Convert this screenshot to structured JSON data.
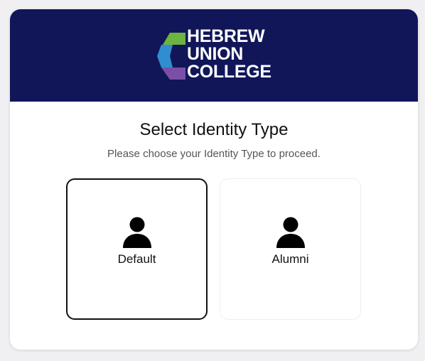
{
  "header": {
    "logo": {
      "lines": [
        "HEBREW",
        "UNION",
        "COLLEGE"
      ],
      "colors": {
        "green": "#6db33f",
        "blue": "#2f8ed0",
        "purple": "#7b4fa6",
        "navy": "#111659"
      }
    }
  },
  "main": {
    "title": "Select Identity Type",
    "subtitle": "Please choose your Identity Type to proceed.",
    "options": [
      {
        "label": "Default",
        "icon": "person-icon",
        "selected": true
      },
      {
        "label": "Alumni",
        "icon": "person-icon",
        "selected": false
      }
    ]
  }
}
